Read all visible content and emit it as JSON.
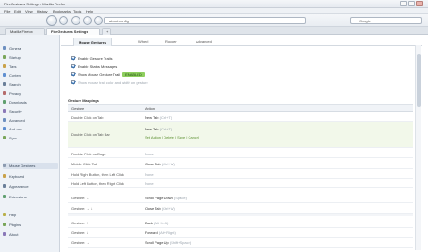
{
  "window": {
    "title": "FireGestures Settings - Mozilla Firefox"
  },
  "menubar": [
    "File",
    "Edit",
    "View",
    "History",
    "Bookmarks",
    "Tools",
    "Help"
  ],
  "toolbar": {
    "url": "about:config",
    "search_placeholder": "Google"
  },
  "tabs": [
    {
      "label": "Mozilla Firefox Start Page"
    },
    {
      "label": "FireGestures Settings"
    }
  ],
  "sidebar": {
    "items": [
      {
        "label": "General",
        "icon": "general-icon",
        "color": "#6d8fc0"
      },
      {
        "label": "Startup",
        "icon": "startup-icon",
        "color": "#7aa65a"
      },
      {
        "label": "Tabs",
        "icon": "tabs-icon",
        "color": "#c9a24a"
      },
      {
        "label": "Content",
        "icon": "content-icon",
        "color": "#5f8fd1"
      },
      {
        "label": "Search",
        "icon": "search-icon",
        "color": "#6a7f99"
      },
      {
        "label": "Privacy",
        "icon": "privacy-icon",
        "color": "#b56c6c"
      },
      {
        "label": "Downloads",
        "icon": "downloads-icon",
        "color": "#5f9f6f"
      },
      {
        "label": "Security",
        "icon": "security-icon",
        "color": "#8a78b8"
      },
      {
        "label": "Advanced",
        "icon": "advanced-icon",
        "color": "#6d8fc0"
      },
      {
        "label": "Add-ons",
        "icon": "addons-icon",
        "color": "#5f8fd1"
      },
      {
        "label": "Sync",
        "icon": "sync-icon",
        "color": "#7aa65a"
      },
      {
        "label": "Mouse Gestures",
        "icon": "gesture-icon",
        "color": "#8c9bb0"
      },
      {
        "label": "Keyboard",
        "icon": "keyboard-icon",
        "color": "#c9a24a"
      },
      {
        "label": "Appearance",
        "icon": "appearance-icon",
        "color": "#6a7f99"
      },
      {
        "label": "Extensions",
        "icon": "extensions-icon",
        "color": "#5f9f6f"
      },
      {
        "label": "Help",
        "icon": "help-icon",
        "color": "#b9b04a"
      },
      {
        "label": "Plugins",
        "icon": "plugins-icon",
        "color": "#7aa65a"
      },
      {
        "label": "About",
        "icon": "about-icon",
        "color": "#8a78b8"
      }
    ]
  },
  "subtabs": [
    {
      "label": "Mouse Gestures"
    },
    {
      "label": "Wheel"
    },
    {
      "label": "Rocker"
    },
    {
      "label": "Advanced"
    }
  ],
  "options": [
    {
      "label": "Enable Gesture Trails"
    },
    {
      "label": "Enable Status Messages"
    },
    {
      "label": "Show Mouse Gesture Trail",
      "badge": "ENABLED"
    },
    {
      "label": "Show mouse trail color and width on gesture"
    }
  ],
  "mapping": {
    "section_title": "Gesture Mappings",
    "col_gesture": "Gesture",
    "col_action": "Action",
    "rows": [
      {
        "gesture": "Double Click on Tab",
        "action": "New Tab",
        "key": "(Ctrl+T)"
      },
      {
        "gesture": "Double Click on Tab Bar",
        "action": "New Tab",
        "key": "(Ctrl+T)",
        "links": "Set Action | Delete | Save | Cancel"
      },
      {
        "gesture": "Double Click on Page",
        "action": "None",
        "key": ""
      },
      {
        "gesture": "Middle Click Tab",
        "action": "Close Tab",
        "key": "(Ctrl+W)"
      },
      {
        "gesture": "Hold Right Button, then Left Click",
        "action": "None",
        "key": ""
      },
      {
        "gesture": "Hold Left Button, then Right Click",
        "action": "None",
        "key": ""
      },
      {
        "gesture": "Gesture: ←",
        "action": "Scroll Page Down",
        "key": "(Space)"
      },
      {
        "gesture": "Gesture: → ↓",
        "action": "Close Tab",
        "key": "(Ctrl+W)"
      },
      {
        "gesture": "Gesture: ↑",
        "action": "Back",
        "key": "(Alt+Left)"
      },
      {
        "gesture": "Gesture: ↓",
        "action": "Forward",
        "key": "(Alt+Right)"
      },
      {
        "gesture": "Gesture: →",
        "action": "Scroll Page Up",
        "key": "(Shift+Space)"
      }
    ]
  }
}
